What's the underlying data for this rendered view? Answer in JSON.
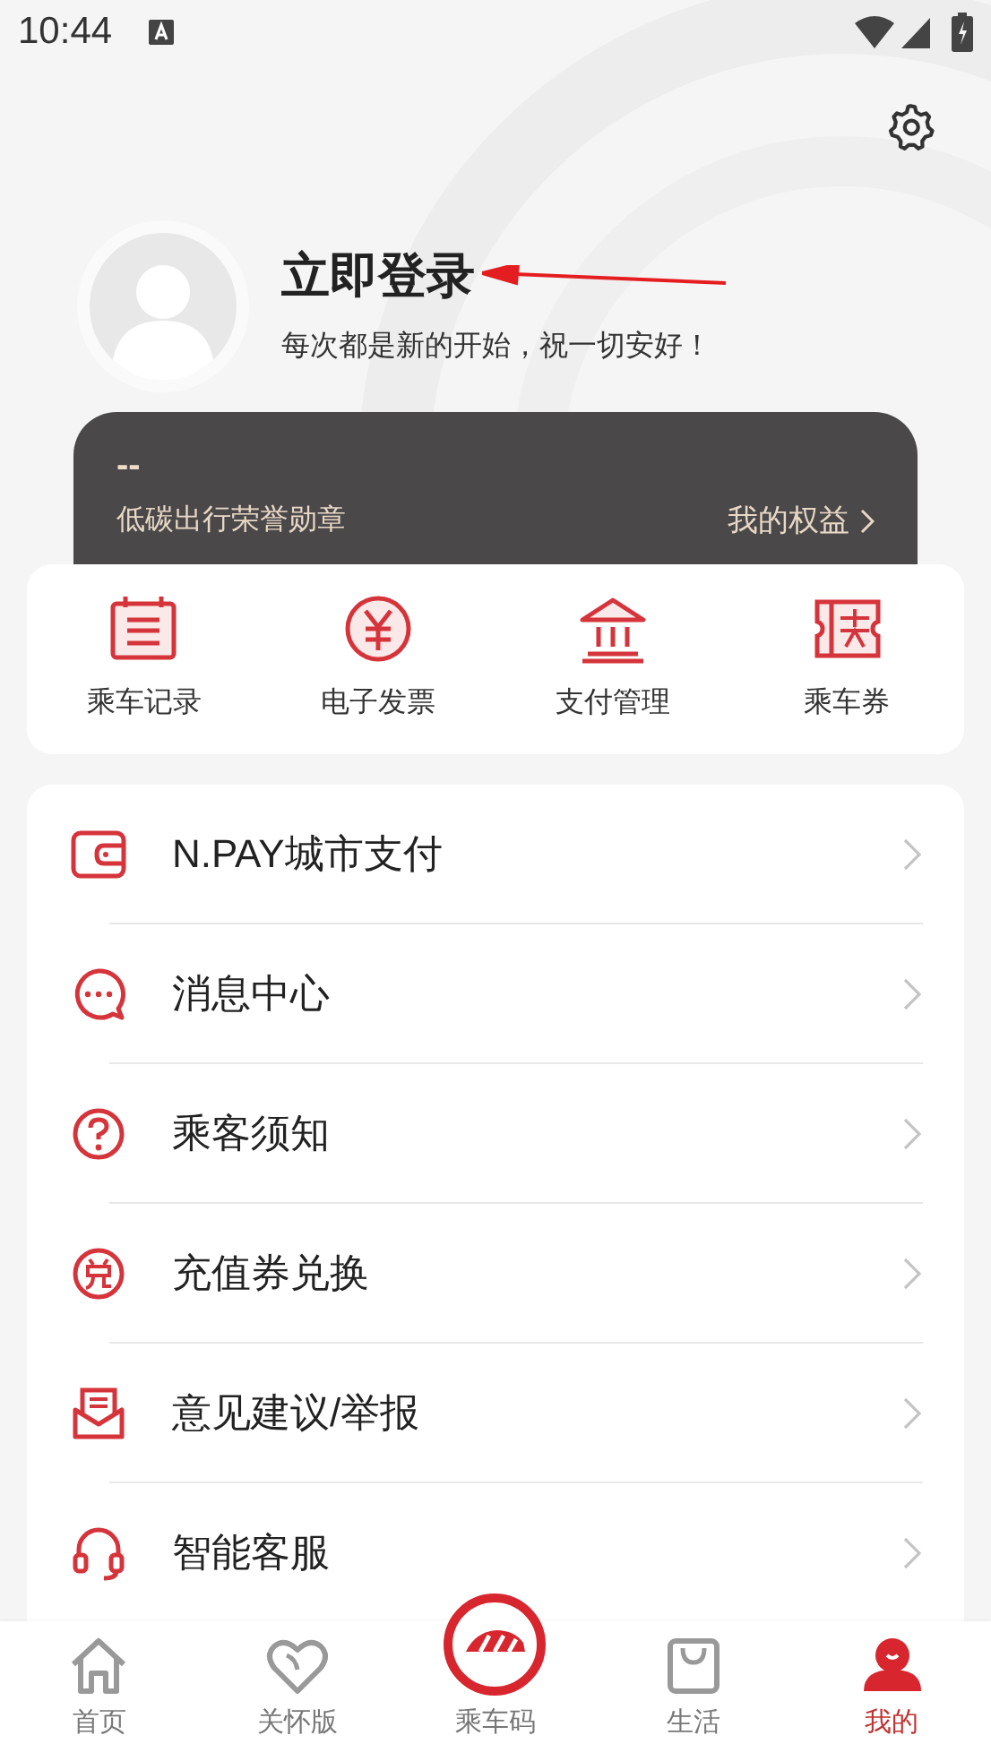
{
  "status_bar": {
    "time": "10:44"
  },
  "profile": {
    "title": "立即登录",
    "subtitle": "每次都是新的开始，祝一切安好！"
  },
  "badge_card": {
    "value": "--",
    "label": "低碳出行荣誉勋章",
    "link": "我的权益"
  },
  "shortcuts": [
    {
      "label": "乘车记录"
    },
    {
      "label": "电子发票"
    },
    {
      "label": "支付管理"
    },
    {
      "label": "乘车券"
    }
  ],
  "menu": [
    {
      "label": "N.PAY城市支付"
    },
    {
      "label": "消息中心"
    },
    {
      "label": "乘客须知"
    },
    {
      "label": "充值券兑换"
    },
    {
      "label": "意见建议/举报"
    },
    {
      "label": "智能客服"
    }
  ],
  "tabs": [
    {
      "label": "首页",
      "selected": false
    },
    {
      "label": "关怀版",
      "selected": false
    },
    {
      "label": "乘车码",
      "selected": false
    },
    {
      "label": "生活",
      "selected": false
    },
    {
      "label": "我的",
      "selected": true
    }
  ]
}
